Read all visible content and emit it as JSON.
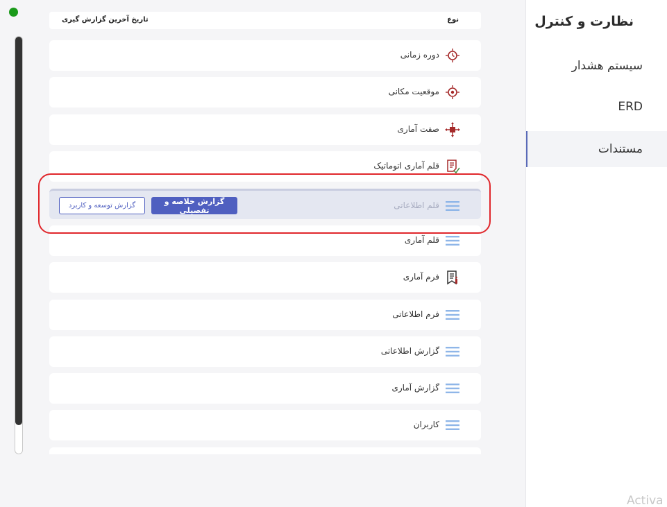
{
  "sidebar": {
    "title": "نظارت و کنترل",
    "items": [
      {
        "label": "سیستم هشدار"
      },
      {
        "label": "ERD"
      },
      {
        "label": "مستندات"
      }
    ]
  },
  "table": {
    "header": {
      "type": "نوع",
      "last_report_date": "تاریخ آخرین گزارش گیری"
    },
    "rows": [
      {
        "label": "دوره زمانی",
        "icon": "clock-target-icon"
      },
      {
        "label": "موقعیت مکانی",
        "icon": "location-target-icon"
      },
      {
        "label": "صفت آماری",
        "icon": "attribute-move-icon"
      },
      {
        "label": "قلم آماری اتوماتیک",
        "icon": "auto-document-icon"
      },
      {
        "label": "قلم اطلاعاتی",
        "icon": "list-icon"
      },
      {
        "label": "قلم آماری",
        "icon": "list-icon"
      },
      {
        "label": "فرم آماری",
        "icon": "form-document-icon"
      },
      {
        "label": "فرم اطلاعاتی",
        "icon": "list-icon"
      },
      {
        "label": "گزارش اطلاعاتی",
        "icon": "list-icon"
      },
      {
        "label": "گزارش آماری",
        "icon": "list-icon"
      },
      {
        "label": "کاربران",
        "icon": "list-icon"
      }
    ],
    "expanded_row": {
      "summary_button": "گزارش خلاصه و تفصیلی",
      "development_button": "گزارش توسعه و کاربرد"
    }
  },
  "watermark": "Activa",
  "colors": {
    "accent": "#4f5fc0",
    "highlight": "#e0262b",
    "icon_red": "#a52a2a",
    "list_icon": "#8fb6e8",
    "status": "#1a9a1a"
  }
}
